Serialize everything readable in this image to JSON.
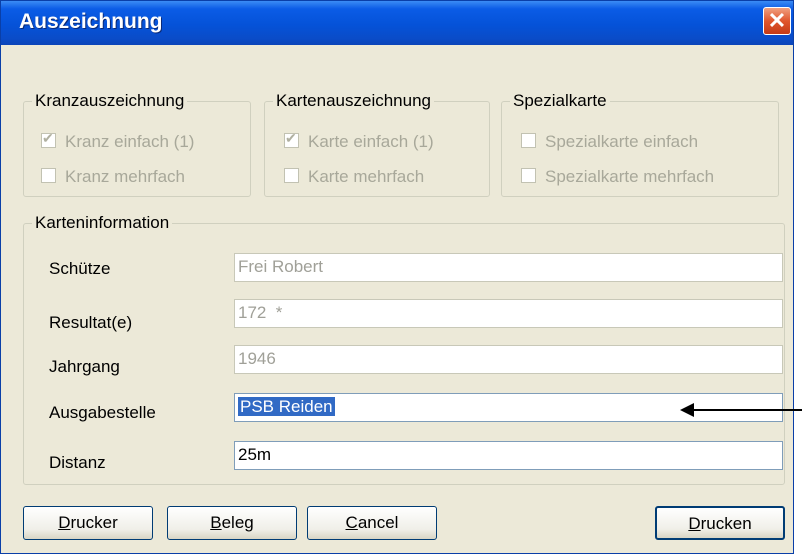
{
  "window": {
    "title": "Auszeichnung",
    "close_icon": "close-icon"
  },
  "kranz": {
    "legend": "Kranzauszeichnung",
    "options": [
      {
        "label": "Kranz einfach (1)",
        "checked": true
      },
      {
        "label": "Kranz mehrfach",
        "checked": false
      }
    ]
  },
  "karten": {
    "legend": "Kartenauszeichnung",
    "options": [
      {
        "label": "Karte einfach (1)",
        "checked": true
      },
      {
        "label": "Karte mehrfach",
        "checked": false
      }
    ]
  },
  "spezial": {
    "legend": "Spezialkarte",
    "options": [
      {
        "label": "Spezialkarte einfach",
        "checked": false
      },
      {
        "label": "Spezialkarte mehrfach",
        "checked": false
      }
    ]
  },
  "info": {
    "legend": "Karteninformation",
    "rows": [
      {
        "label": "Schütze",
        "value": "Frei Robert"
      },
      {
        "label": "Resultat(e)",
        "value": "172  *"
      },
      {
        "label": "Jahrgang",
        "value": "1946"
      },
      {
        "label": "Ausgabestelle",
        "value": "PSB Reiden"
      },
      {
        "label": "Distanz",
        "value": "25m"
      }
    ]
  },
  "buttons": {
    "drucker": {
      "pre": "",
      "ul": "D",
      "post": "rucker"
    },
    "beleg": {
      "pre": "",
      "ul": "B",
      "post": "eleg"
    },
    "cancel": {
      "pre": "",
      "ul": "C",
      "post": "ancel"
    },
    "drucken": {
      "pre": "",
      "ul": "D",
      "post": "rucken"
    }
  }
}
